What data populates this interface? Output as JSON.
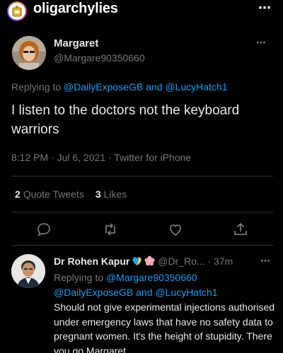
{
  "instagram": {
    "username": "oligarchylies",
    "more_icon": "⋯"
  },
  "tweet": {
    "author_name": "Margaret",
    "author_handle": "@Margare90350660",
    "more_icon": "⋯",
    "replying_prefix": "Replying to",
    "replying_to_1": "@DailyExposeGB",
    "replying_and": "and",
    "replying_to_2": "@LucyHatch1",
    "text": "I listen to the doctors not the keyboard warriors",
    "timestamp": "8:12 PM · Jul 6, 2021 · Twitter for iPhone",
    "quote_tweets_count": "2",
    "quote_tweets_label": "Quote Tweets",
    "likes_count": "3",
    "likes_label": "Likes",
    "action_icons": [
      "reply-icon",
      "retweet-icon",
      "like-icon",
      "share-icon"
    ]
  },
  "reply": {
    "author_name": "Dr Rohen Kapur",
    "badges": [
      "heart-emoji",
      "flower-emoji"
    ],
    "author_handle": "@Dr_Ro...",
    "time": "· 37m",
    "more_icon": "⋯",
    "replying_prefix": "Replying to",
    "replying_to_1": "@Margare90350660",
    "replying_to_2": "@DailyExposeGB",
    "replying_and": "and",
    "replying_to_3": "@LucyHatch1",
    "text": "Should not give experimental injections authorised under emergency laws that have no safety data to pregnant women.  It's the height of stupidity.  There you go Margaret."
  },
  "colors": {
    "background": "#000000",
    "text": "#e7e9ea",
    "secondary": "#71767b",
    "link": "#1d9bf0",
    "divider": "#2f3336"
  }
}
